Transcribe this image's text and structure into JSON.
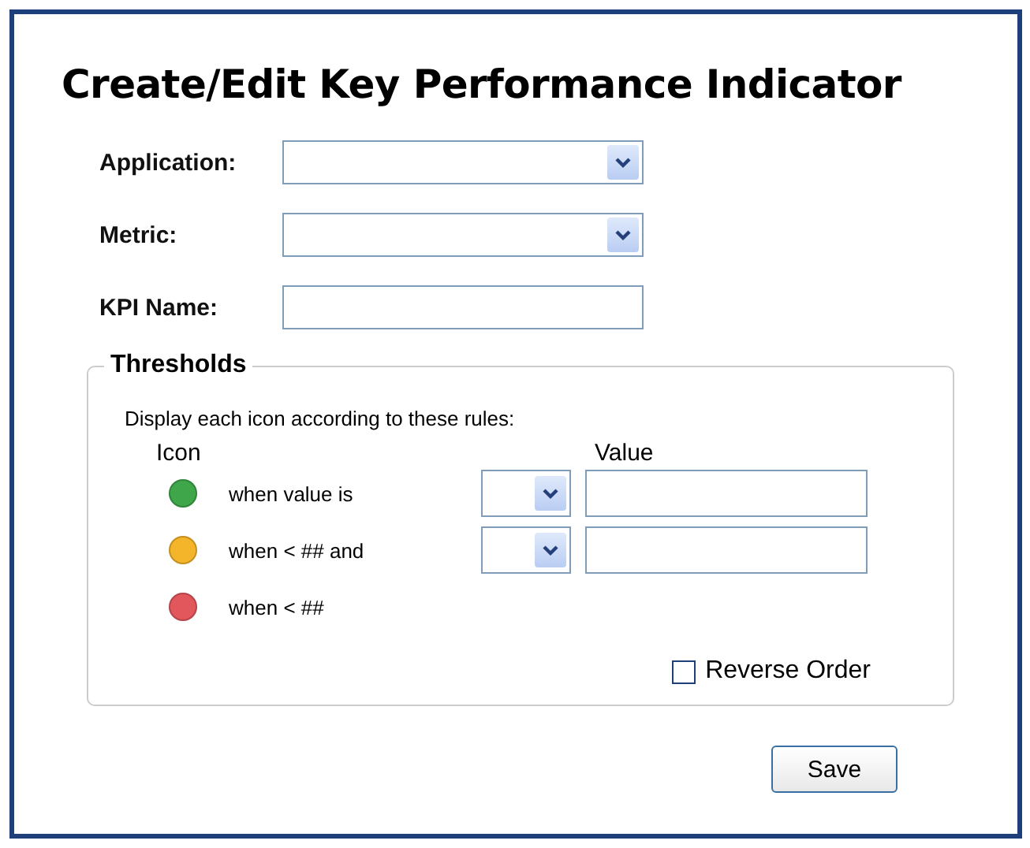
{
  "title": "Create/Edit Key Performance Indicator",
  "fields": [
    {
      "label": "Application:",
      "kind": "dropdown"
    },
    {
      "label": "Metric:",
      "kind": "dropdown"
    },
    {
      "label": "KPI Name:",
      "kind": "text"
    }
  ],
  "thresholds": {
    "legend": "Thresholds",
    "instruction": "Display each icon according to these rules:",
    "icon_header": "Icon",
    "value_header": "Value",
    "rules": [
      {
        "text": "when value is",
        "color": "#3fa64a",
        "kind": "compare"
      },
      {
        "text": "when < ## and",
        "color": "#f5b52a",
        "kind": "compare"
      },
      {
        "text": "when < ##",
        "color": "#e2575c",
        "kind": "plain"
      }
    ],
    "reverse_order": {
      "label": "Reverse Order",
      "checked": false
    }
  },
  "save_button": "Save"
}
